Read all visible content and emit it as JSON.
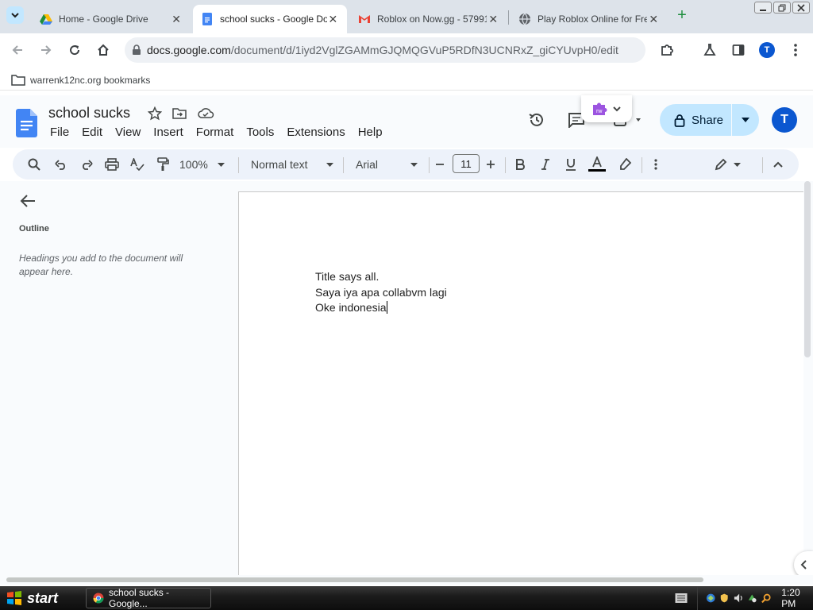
{
  "browser": {
    "tabs": [
      {
        "title": "Home - Google Drive",
        "icon": "google-drive-icon",
        "active": false
      },
      {
        "title": "school sucks - Google Docs",
        "icon": "google-docs-icon",
        "active": true
      },
      {
        "title": "Roblox on Now.gg - 57991...",
        "icon": "gmail-icon",
        "active": false
      },
      {
        "title": "Play Roblox Online for Free",
        "icon": "globe-icon",
        "active": false
      }
    ],
    "url_host": "docs.google.com",
    "url_path": "/document/d/1iyd2VglZGAMmGJQMQGVuP5RDfN3UCNRxZ_giCYUvpH0/edit",
    "profile_initial": "T",
    "bookmarks_label": "warrenk12nc.org bookmarks"
  },
  "docs": {
    "title": "school sucks",
    "menu": [
      "File",
      "Edit",
      "View",
      "Insert",
      "Format",
      "Tools",
      "Extensions",
      "Help"
    ],
    "share_label": "Share",
    "user_initial": "T",
    "extension_badge": "rw",
    "toolbar": {
      "zoom": "100%",
      "style": "Normal text",
      "font": "Arial",
      "font_size": "11"
    },
    "outline": {
      "title": "Outline",
      "hint": "Headings you add to the document will appear here."
    },
    "body_lines": [
      "Title says all.",
      "Saya iya apa collabvm lagi",
      "Oke indonesia"
    ]
  },
  "taskbar": {
    "start_label": "start",
    "task_label": "school sucks - Google...",
    "clock": "1:20 PM"
  },
  "colors": {
    "accent": "#0b57d0",
    "share_bg": "#c2e7ff",
    "docs_blue": "#4285f4",
    "toolbar_bg": "#edf2fa"
  }
}
